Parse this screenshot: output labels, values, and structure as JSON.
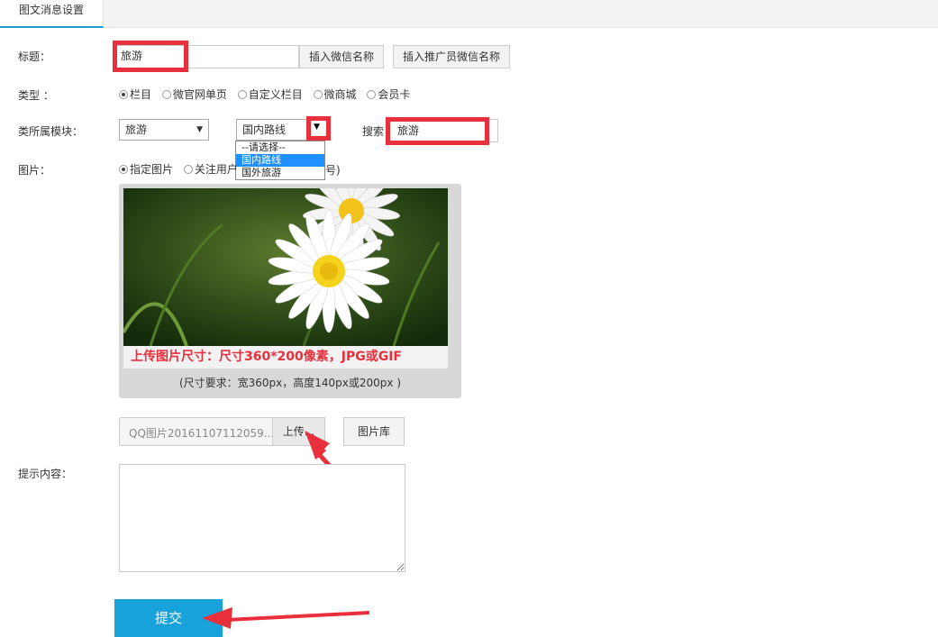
{
  "tab": {
    "label": "图文消息设置"
  },
  "title_row": {
    "label": "标题：",
    "value": "旅游",
    "insert_wechat_name": "插入微信名称",
    "insert_promoter_name": "插入推广员微信名称"
  },
  "type_row": {
    "label": "类型 ：",
    "options": [
      "栏目",
      "微官网单页",
      "自定义栏目",
      "微商城",
      "会员卡"
    ],
    "selected": "栏目"
  },
  "module_row": {
    "label": "类所属模块：",
    "select1_value": "旅游",
    "select2_value": "国内路线",
    "dropdown_options": [
      "--请选择--",
      "国内路线",
      "国外旅游"
    ],
    "search_label": "搜索",
    "search_value": "旅游"
  },
  "image_row": {
    "label": "图片：",
    "options": [
      "指定图片",
      "关注用户"
    ],
    "option_tail": "号)",
    "banner_text": "上传图片尺寸：尺寸360*200像素，JPG或GIF",
    "size_hint": "(尺寸要求：宽360px，高度140px或200px )"
  },
  "upload": {
    "filename": "QQ图片20161107112059....",
    "upload_button": "上传...",
    "gallery_button": "图片库"
  },
  "content_row": {
    "label": "提示内容："
  },
  "submit": {
    "label": "提交"
  },
  "colors": {
    "accent": "#17a3d9",
    "highlight": "#e8303d",
    "tab_underline": "#1e9ad6"
  }
}
